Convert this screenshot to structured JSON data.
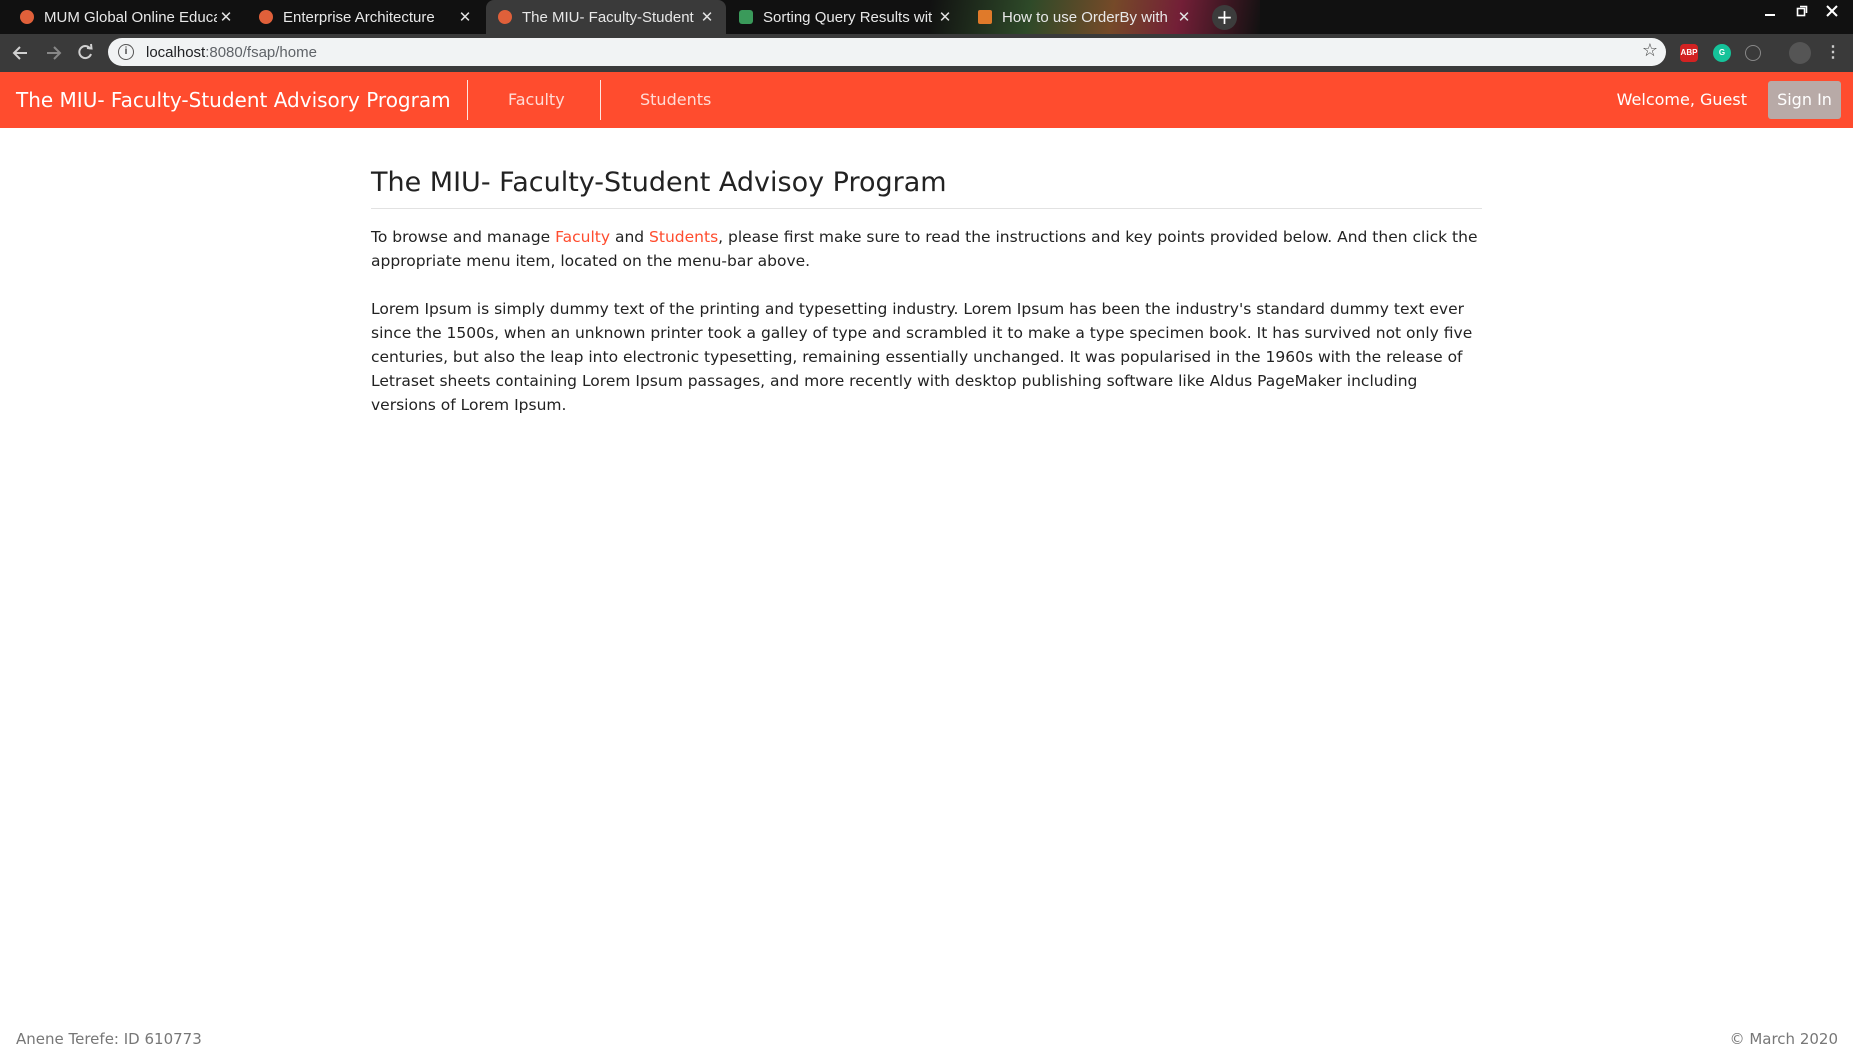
{
  "browser": {
    "tabs": [
      {
        "title": "MUM Global Online Educa",
        "favicon": "mum-favicon-icon",
        "active": false
      },
      {
        "title": "Enterprise Architecture",
        "favicon": "mum-favicon-icon",
        "active": false
      },
      {
        "title": "The MIU- Faculty-Student",
        "favicon": "mum-favicon-icon",
        "active": true
      },
      {
        "title": "Sorting Query Results wit",
        "favicon": "leaf-icon",
        "active": false
      },
      {
        "title": "How to use OrderBy with",
        "favicon": "stackoverflow-icon",
        "active": false
      }
    ],
    "close_glyph": "✕",
    "new_tab_glyph": "+",
    "url_host": "localhost",
    "url_rest": ":8080/fsap/home",
    "extensions": [
      "ABP",
      "G"
    ]
  },
  "navbar": {
    "brand": "The MIU- Faculty-Student Advisory Program",
    "links": [
      "Faculty",
      "Students"
    ],
    "welcome": "Welcome, Guest",
    "signin": "Sign In"
  },
  "content": {
    "heading": "The MIU- Faculty-Student Advisoy Program",
    "intro_before": "To browse and manage ",
    "intro_faculty": "Faculty",
    "intro_and": " and ",
    "intro_students": "Students",
    "intro_after": ", please first make sure to read the instructions and key points provided below. And then click the appropriate menu item, located on the menu-bar above.",
    "lorem": "Lorem Ipsum is simply dummy text of the printing and typesetting industry. Lorem Ipsum has been the industry's standard dummy text ever since the 1500s, when an unknown printer took a galley of type and scrambled it to make a type specimen book. It has survived not only five centuries, but also the leap into electronic typesetting, remaining essentially unchanged. It was popularised in the 1960s with the release of Letraset sheets containing Lorem Ipsum passages, and more recently with desktop publishing software like Aldus PageMaker including versions of Lorem Ipsum."
  },
  "footer": {
    "left": "Anene Terefe: ID 610773",
    "right": "© March 2020"
  },
  "colors": {
    "accent": "#ff4c2e",
    "signin_bg": "#b8aaa7"
  }
}
